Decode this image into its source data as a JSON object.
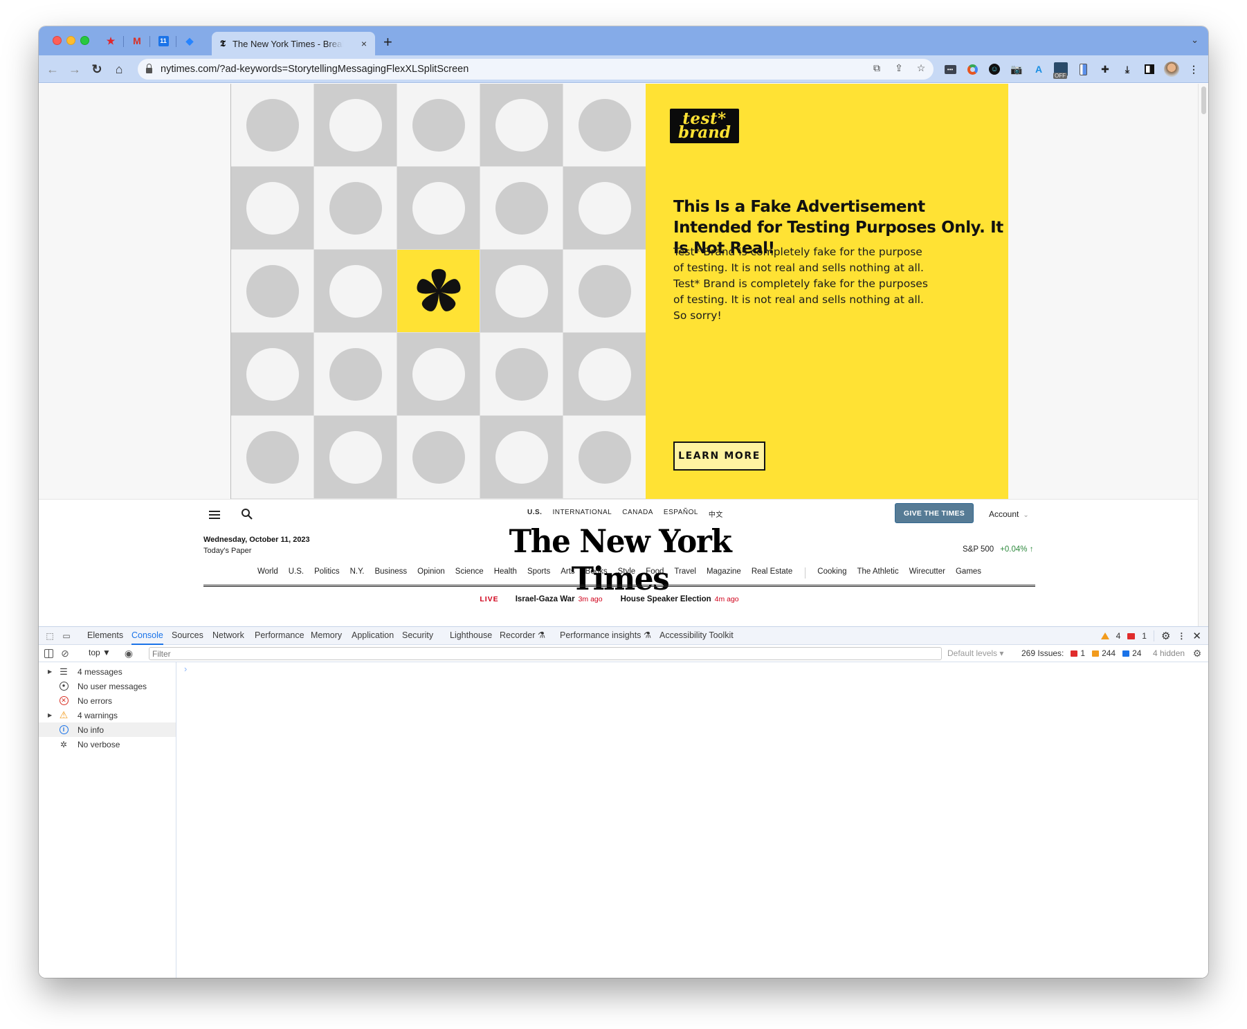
{
  "browser": {
    "pinned_tabs": [
      {
        "name": "pinned-tab-star",
        "glyph": "★",
        "color": "#e0252b"
      },
      {
        "name": "pinned-tab-gmail",
        "glyph": "M",
        "color": "#d93025"
      },
      {
        "name": "pinned-tab-calendar",
        "glyph": "11",
        "color": "#1a73e8"
      },
      {
        "name": "pinned-tab-jira",
        "glyph": "◆",
        "color": "#2684ff"
      }
    ],
    "active_tab": {
      "favicon": "𝕿",
      "title": "The New York Times - Breaking News, US News, World News",
      "close": "×"
    },
    "new_tab": "+",
    "url": "nytimes.com/?ad-keywords=StorytellingMessagingFlexXLSplitScreen",
    "extension_badge": "OFF"
  },
  "ad": {
    "brand_line1": "test*",
    "brand_line2": "brand",
    "headline": "This Is a Fake Advertisement Intended for Testing Purposes Only. It Is Not Real!",
    "body_lines": [
      "Test* Brand is completely fake for the purpose",
      "of testing. It is not real and sells nothing at all.",
      "Test* Brand is completely fake for the purposes",
      "of testing. It is not real and sells nothing at all.",
      "So sorry!"
    ],
    "cta": "LEARN MORE",
    "colors": {
      "yellow": "#ffe234",
      "light": "#f4f4f4",
      "dark": "#cdcdcd"
    }
  },
  "nyt": {
    "editions": [
      "U.S.",
      "INTERNATIONAL",
      "CANADA",
      "ESPAÑOL",
      "中文"
    ],
    "give_button": "GIVE THE TIMES",
    "account": "Account",
    "date": "Wednesday, October 11, 2023",
    "todays_paper": "Today's Paper",
    "masthead": "The New York Times",
    "ticker_label": "S&P 500",
    "ticker_value": "+0.04% ↑",
    "sections": [
      "World",
      "U.S.",
      "Politics",
      "N.Y.",
      "Business",
      "Opinion",
      "Science",
      "Health",
      "Sports",
      "Arts",
      "Books",
      "Style",
      "Food",
      "Travel",
      "Magazine",
      "Real Estate"
    ],
    "products": [
      "Cooking",
      "The Athletic",
      "Wirecutter",
      "Games"
    ],
    "live_label": "LIVE",
    "live_items": [
      {
        "title": "Israel-Gaza War",
        "ago": "3m ago"
      },
      {
        "title": "House Speaker Election",
        "ago": "4m ago"
      }
    ]
  },
  "devtools": {
    "tabs": [
      {
        "label": "Elements",
        "active": false
      },
      {
        "label": "Console",
        "active": true
      },
      {
        "label": "Sources",
        "active": false
      },
      {
        "label": "Network",
        "active": false
      },
      {
        "label": "Performance",
        "active": false
      },
      {
        "label": "Memory",
        "active": false
      },
      {
        "label": "Application",
        "active": false
      },
      {
        "label": "Security",
        "active": false
      },
      {
        "label": "Lighthouse",
        "active": false
      },
      {
        "label": "Recorder ⚗",
        "active": false
      },
      {
        "label": "Performance insights ⚗",
        "active": false
      },
      {
        "label": "Accessibility Toolkit",
        "active": false
      }
    ],
    "warning_count": "4",
    "error_count": "1",
    "context": "top ▼",
    "filter_placeholder": "Filter",
    "levels": "Default levels ▾",
    "issues_label": "269 Issues:",
    "issues_error": "1",
    "issues_warning": "244",
    "issues_info": "24",
    "hidden": "4 hidden",
    "sidebar": [
      {
        "label": "4 messages",
        "icon": "list-icon",
        "expandable": true,
        "selected": false
      },
      {
        "label": "No user messages",
        "icon": "user-icon",
        "expandable": false,
        "selected": false
      },
      {
        "label": "No errors",
        "icon": "error-icon",
        "expandable": false,
        "selected": false
      },
      {
        "label": "4 warnings",
        "icon": "warning-icon",
        "expandable": true,
        "selected": false
      },
      {
        "label": "No info",
        "icon": "info-icon",
        "expandable": false,
        "selected": true
      },
      {
        "label": "No verbose",
        "icon": "bug-icon",
        "expandable": false,
        "selected": false
      }
    ],
    "prompt": "›"
  }
}
